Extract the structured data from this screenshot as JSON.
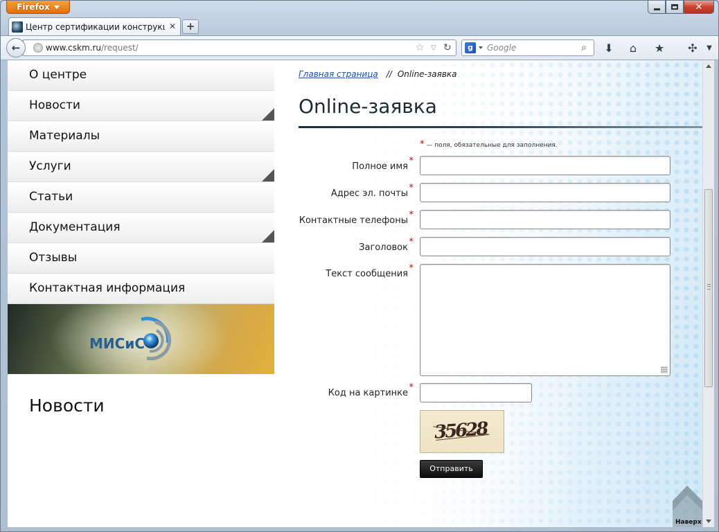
{
  "browser": {
    "app_button": "Firefox",
    "tab": {
      "title": "Центр сертификации конструкционны..."
    },
    "url": {
      "host": "www.cskm.ru",
      "path": "/request/"
    },
    "search": {
      "placeholder": "Google"
    }
  },
  "sidebar": {
    "items": [
      {
        "label": "О центре",
        "fold": false
      },
      {
        "label": "Новости",
        "fold": true
      },
      {
        "label": "Материалы",
        "fold": false
      },
      {
        "label": "Услуги",
        "fold": true
      },
      {
        "label": "Статьи",
        "fold": false
      },
      {
        "label": "Документация",
        "fold": true
      },
      {
        "label": "Отзывы",
        "fold": false
      },
      {
        "label": "Контактная информация",
        "fold": false
      }
    ],
    "logo_text": "МИСиС",
    "news_heading": "Новости"
  },
  "main": {
    "breadcrumb": {
      "home": "Главная страница",
      "separator": "//",
      "current": "Online-заявка"
    },
    "title": "Online-заявка",
    "required_star": "*",
    "required_note": "— поля, обязательные для заполнения.",
    "form": {
      "fields": [
        {
          "label": "Полное имя",
          "value": ""
        },
        {
          "label": "Адрес эл. почты",
          "value": ""
        },
        {
          "label": "Контактные телефоны",
          "value": ""
        },
        {
          "label": "Заголовок",
          "value": ""
        },
        {
          "label": "Текст сообщения",
          "value": ""
        },
        {
          "label": "Код на картинке",
          "value": ""
        }
      ],
      "captcha_text": "35628",
      "submit_label": "Отправить"
    },
    "to_top_label": "Наверх"
  },
  "colors": {
    "required": "#cc0000",
    "link": "#1a4fa8",
    "button": "#111111",
    "logo": "#2a5e8f"
  }
}
